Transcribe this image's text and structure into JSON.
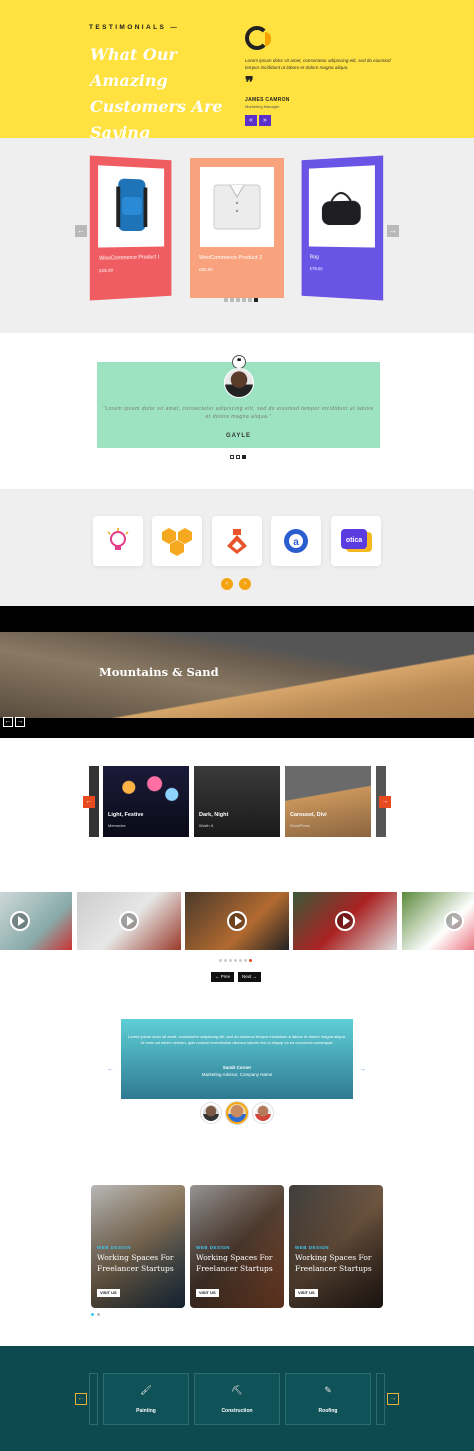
{
  "colors": {
    "yellow": "#ffe13f",
    "purple": "#5b2fc9",
    "mint": "#9de3c2",
    "orange": "#f4a40f",
    "red": "#e64a1e",
    "teal_dark": "#0c4a4f"
  },
  "testimonials_1": {
    "eyebrow": "TESTIMONIALS —",
    "heading": "What Our Amazing Customers Are Saying",
    "quote": "Lorem ipsum dolor sit amet, consectetur adipiscing elit, sed do eiusmod tempor incididunt ut labore et dolore magna aliqua.",
    "quote_mark": "❞",
    "name": "JAMES CAMRON",
    "role": "Marketing Manager",
    "prev_label": "«",
    "next_label": "»"
  },
  "products": {
    "items": [
      {
        "name": "WooCommerce Product I",
        "price": "£25.00",
        "color": "#ef5d62"
      },
      {
        "name": "WooCommerce Product 2",
        "price": "£50.00",
        "color": "#f8a27e"
      },
      {
        "name": "Bag",
        "price": "£79.00",
        "color": "#6a54e6"
      }
    ],
    "prev": "←",
    "next": "→"
  },
  "testimonial_2": {
    "quote_icon": "❝",
    "text": "“Lorem ipsum dolor sit amet, consectetur adipiscing elit, sed do eiusmod tempor incididunt ut labore et dolore magna aliqua.”",
    "name": "GAYLE"
  },
  "logos": {
    "items": [
      "lightbulb-logo",
      "honeycomb-logo",
      "flask-logo",
      "letter-a-badge-logo",
      "otica-logo"
    ],
    "otica_text": "otica",
    "a_text": "a",
    "prev": "‹",
    "next": "›"
  },
  "hero_slide": {
    "title": "Mountains & Sand",
    "prev": "←",
    "next": "→"
  },
  "gallery": {
    "items": [
      {
        "title": "Light, Festive",
        "sub": "Memories"
      },
      {
        "title": "Dark, Night",
        "sub": "Worth It"
      },
      {
        "title": "Carousel, Divi",
        "sub": "WordPress"
      }
    ],
    "prev": "←",
    "next": "→"
  },
  "videos": {
    "prev_label": "← Prev",
    "next_label": "Next →"
  },
  "testimonial_3": {
    "text": "Lorem ipsum dolor sit amet, consectetur adipiscing elit, sed do eiusmod tempor incididunt ut labore et dolore magna aliqua. Ut enim ad minim veniam, quis nostrud exercitation ullamco laboris nisi ut aliquip ex ea commodo consequat.",
    "name": "Sarah Corner",
    "role": "Marketing Advisor, Company Name",
    "prev": "←",
    "next": "→"
  },
  "blog": {
    "items": [
      {
        "category": "WEB DESIGN",
        "title": "Working Spaces For Freelancer Startups",
        "button": "VISIT US"
      },
      {
        "category": "WEB DESIGN",
        "title": "Working Spaces For Freelancer Startups",
        "button": "VISIT US"
      },
      {
        "category": "WEB DESIGN",
        "title": "Working Spaces For Freelancer Startups",
        "button": "VISIT US"
      }
    ]
  },
  "services": {
    "items": [
      {
        "label": "Painting",
        "icon": "paint-roller-icon",
        "glyph": "🖌"
      },
      {
        "label": "Construction",
        "icon": "brick-trowel-icon",
        "glyph": "⛏"
      },
      {
        "label": "Roofing",
        "icon": "roof-tool-icon",
        "glyph": "✎"
      }
    ],
    "prev": "←",
    "next": "→"
  }
}
